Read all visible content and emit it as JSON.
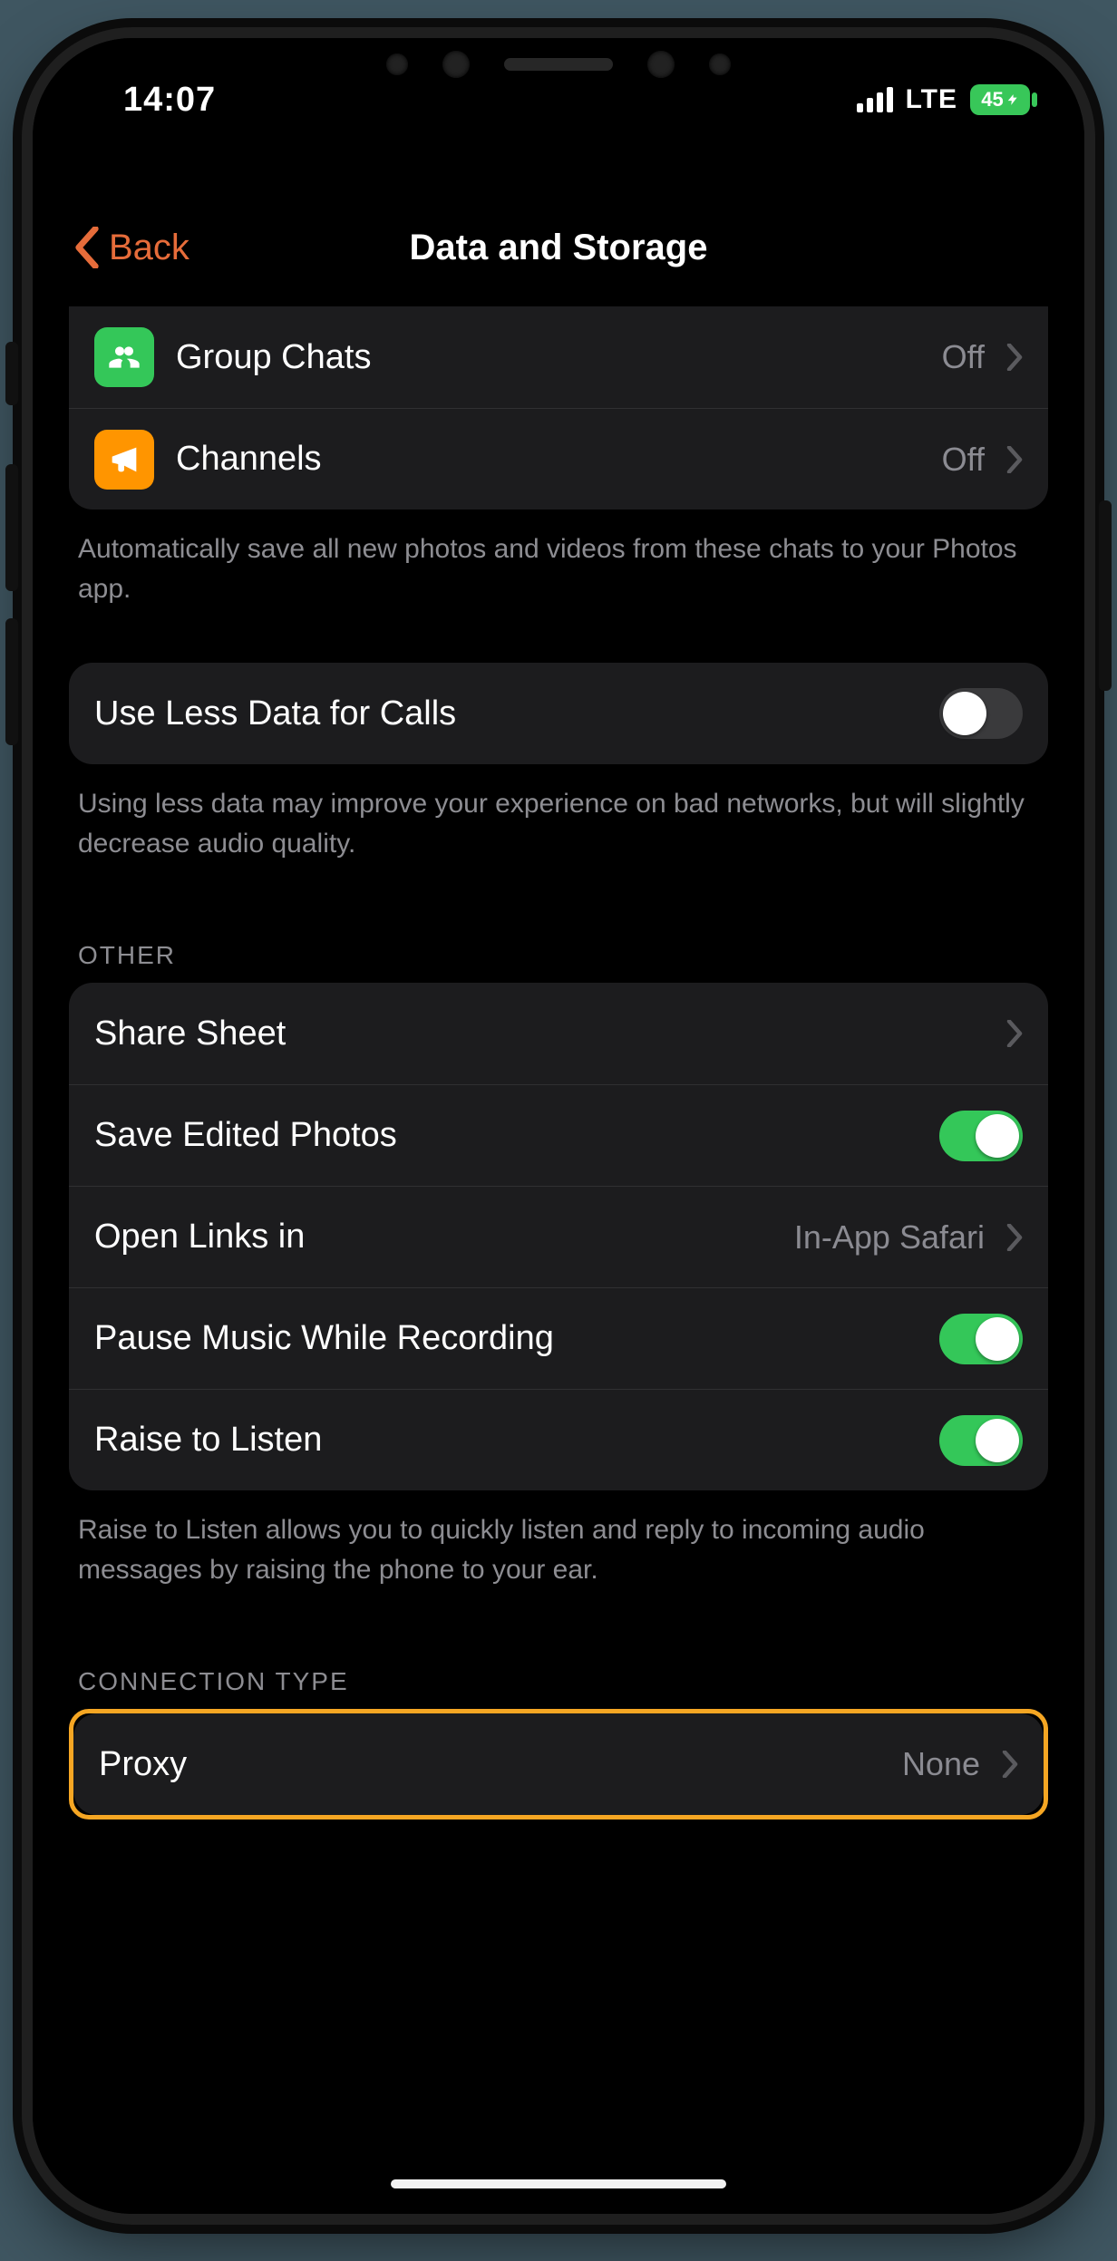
{
  "status": {
    "time": "14:07",
    "network": "LTE",
    "battery": "45"
  },
  "nav": {
    "back": "Back",
    "title": "Data and Storage"
  },
  "autosave": {
    "groupChats": {
      "label": "Group Chats",
      "value": "Off"
    },
    "channels": {
      "label": "Channels",
      "value": "Off"
    },
    "footer": "Automatically save all new photos and videos from these chats to your Photos app."
  },
  "calls": {
    "lessData": {
      "label": "Use Less Data for Calls",
      "on": false
    },
    "footer": "Using less data may improve your experience on bad networks, but will slightly decrease audio quality."
  },
  "other": {
    "header": "OTHER",
    "shareSheet": {
      "label": "Share Sheet"
    },
    "savePhotos": {
      "label": "Save Edited Photos",
      "on": true
    },
    "openLinks": {
      "label": "Open Links in",
      "value": "In-App Safari"
    },
    "pauseMusic": {
      "label": "Pause Music While Recording",
      "on": true
    },
    "raiseListen": {
      "label": "Raise to Listen",
      "on": true
    },
    "footer": "Raise to Listen allows you to quickly listen and reply to incoming audio messages by raising the phone to your ear."
  },
  "connection": {
    "header": "CONNECTION TYPE",
    "proxy": {
      "label": "Proxy",
      "value": "None"
    }
  }
}
